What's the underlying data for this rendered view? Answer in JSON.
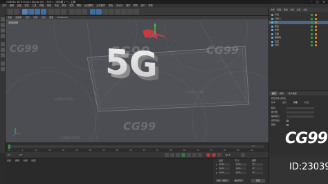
{
  "window": {
    "title": "CINEMA 4D R19.024 Studio (RC - R19) - [未标题 1 *] - 主要",
    "controls": [
      "–",
      "□",
      "×"
    ]
  },
  "menubar": {
    "items": [
      "文件",
      "编辑",
      "创建",
      "选择",
      "工具",
      "网格",
      "捕捉",
      "动画",
      "模拟",
      "渲染",
      "雕刻",
      "运动跟踪",
      "运动图形",
      "角色",
      "流水线",
      "插件",
      "脚本",
      "窗口",
      "帮助"
    ]
  },
  "viewport": {
    "menu": [
      "查看",
      "摄像机",
      "显示",
      "选项",
      "过滤",
      "面板",
      "ProRender"
    ],
    "label": "透视视图",
    "scene_text": "5G"
  },
  "objects": {
    "tabs": [
      "文件",
      "编辑",
      "查看",
      "对象",
      "标签",
      "书签"
    ],
    "rows": [
      {
        "name": "灯光",
        "selected": false
      },
      {
        "name": "灯光.1",
        "selected": false
      },
      {
        "name": "5G",
        "selected": true
      },
      {
        "name": "挤压",
        "selected": false
      },
      {
        "name": "文本",
        "selected": false
      },
      {
        "name": "平面",
        "selected": false
      },
      {
        "name": "摄像机",
        "selected": false
      },
      {
        "name": "天空",
        "selected": false
      },
      {
        "name": "背景",
        "selected": false
      }
    ]
  },
  "attributes": {
    "tabs": [
      "模式",
      "编辑",
      "用户数据"
    ],
    "header": "挤压对象 [挤压]",
    "sections": [
      "基本",
      "坐标",
      "对象",
      "封顶"
    ],
    "lines": [
      {
        "label": "移动",
        "kind": "field"
      },
      {
        "label": "细分数",
        "kind": "field"
      },
      {
        "label": "等参细分",
        "kind": "field"
      },
      {
        "label": "反转法线",
        "kind": "check"
      },
      {
        "label": "层级",
        "kind": "check"
      }
    ]
  },
  "timeline": {
    "ticks": [
      "0",
      "5",
      "10",
      "15",
      "20",
      "25",
      "30",
      "35",
      "40",
      "45",
      "50",
      "55",
      "60",
      "65",
      "70",
      "75",
      "80",
      "85",
      "90"
    ],
    "end_label": "0 F",
    "current_frame": "0 F",
    "start_field": "0 F",
    "end_field": "90 F"
  },
  "materials": {
    "menu": [
      "创建",
      "编辑",
      "功能",
      "纹理"
    ]
  },
  "coordinates": {
    "headers": [
      "位置",
      "尺寸",
      "旋转"
    ],
    "rows": [
      {
        "axis": "X",
        "pos": "0 cm",
        "size": "0 cm",
        "rot": "0 °"
      },
      {
        "axis": "Y",
        "pos": "0 cm",
        "size": "0 cm",
        "rot": "0 °"
      },
      {
        "axis": "Z",
        "pos": "0 cm",
        "size": "0 cm",
        "rot": "0 °"
      }
    ],
    "mode_left": "对象（相对）",
    "mode_right": "绝对尺寸",
    "apply_label": "应用"
  },
  "watermark": {
    "text": "CG99",
    "small_text": "CG99.COM"
  },
  "brand": {
    "logo": "CG99",
    "id": "ID:230392"
  },
  "colors": {
    "viewport_bg": "#4b4d52",
    "accent_green": "#2ea043",
    "accent_blue": "#3d6fa6"
  }
}
